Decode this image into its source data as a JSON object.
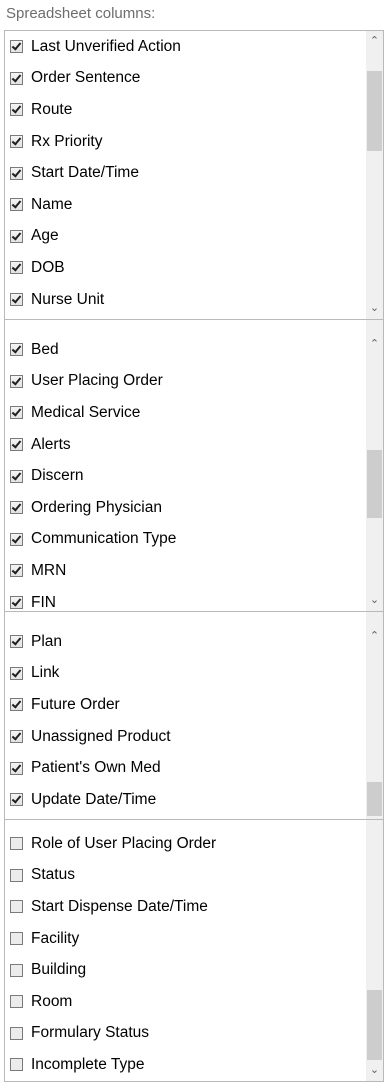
{
  "heading": "Spreadsheet columns:",
  "panels": [
    {
      "items": [
        {
          "label": "Last Unverified Action",
          "checked": true
        },
        {
          "label": "Order Sentence",
          "checked": true
        },
        {
          "label": "Route",
          "checked": true
        },
        {
          "label": "Rx Priority",
          "checked": true
        },
        {
          "label": "Start Date/Time",
          "checked": true
        },
        {
          "label": "Name",
          "checked": true
        },
        {
          "label": "Age",
          "checked": true
        },
        {
          "label": "DOB",
          "checked": true
        },
        {
          "label": "Nurse Unit",
          "checked": true
        }
      ]
    },
    {
      "items": [
        {
          "label": "Bed",
          "checked": true
        },
        {
          "label": "User Placing Order",
          "checked": true
        },
        {
          "label": "Medical Service",
          "checked": true
        },
        {
          "label": "Alerts",
          "checked": true
        },
        {
          "label": "Discern",
          "checked": true
        },
        {
          "label": "Ordering Physician",
          "checked": true
        },
        {
          "label": "Communication Type",
          "checked": true
        },
        {
          "label": "MRN",
          "checked": true
        },
        {
          "label": "FIN",
          "checked": true
        }
      ]
    },
    {
      "items": [
        {
          "label": "Plan",
          "checked": true
        },
        {
          "label": "Link",
          "checked": true
        },
        {
          "label": "Future Order",
          "checked": true
        },
        {
          "label": "Unassigned Product",
          "checked": true
        },
        {
          "label": "Patient's Own Med",
          "checked": true
        },
        {
          "label": "Update Date/Time",
          "checked": true
        }
      ]
    },
    {
      "items": [
        {
          "label": "Role of User Placing Order",
          "checked": false
        },
        {
          "label": "Status",
          "checked": false
        },
        {
          "label": "Start Dispense Date/Time",
          "checked": false
        },
        {
          "label": "Facility",
          "checked": false
        },
        {
          "label": "Building",
          "checked": false
        },
        {
          "label": "Room",
          "checked": false
        },
        {
          "label": "Formulary Status",
          "checked": false
        },
        {
          "label": "Incomplete Type",
          "checked": false
        }
      ]
    }
  ],
  "icons": {
    "scroll_up": "chevron-up-icon",
    "scroll_down": "chevron-down-icon"
  }
}
